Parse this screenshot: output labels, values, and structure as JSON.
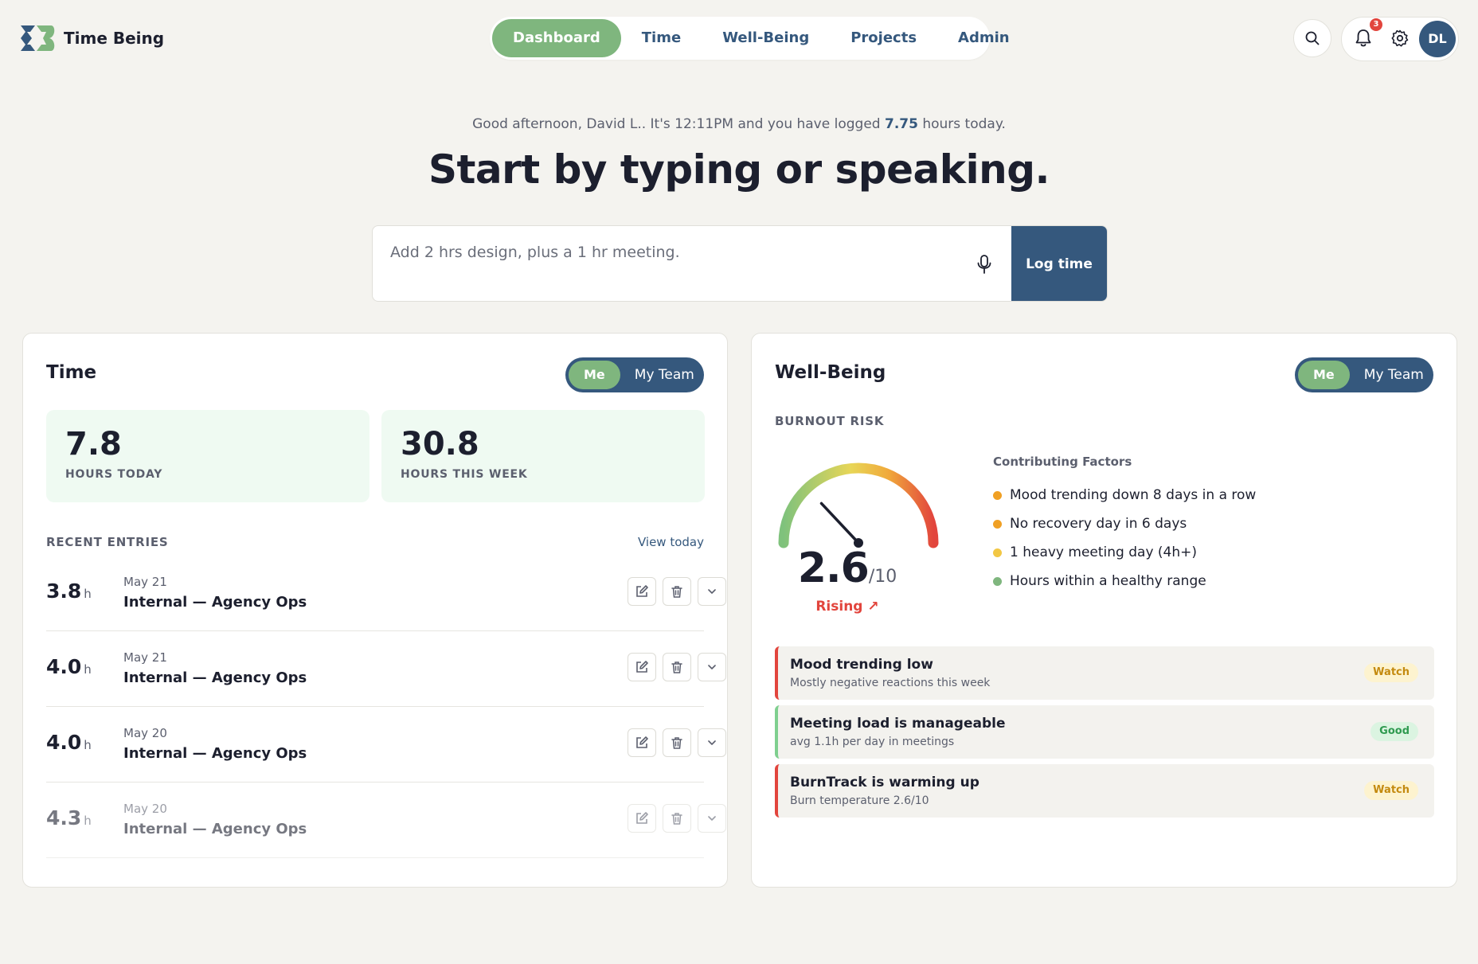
{
  "app": {
    "name": "Time Being"
  },
  "nav": {
    "items": [
      {
        "label": "Dashboard",
        "active": true
      },
      {
        "label": "Time",
        "active": false
      },
      {
        "label": "Well-Being",
        "active": false
      },
      {
        "label": "Projects",
        "active": false
      },
      {
        "label": "Admin",
        "active": false
      }
    ]
  },
  "header": {
    "notification_count": "3",
    "avatar_initials": "DL"
  },
  "hero": {
    "greeting_prefix": "Good afternoon, David L.. It's 12:11PM and you have logged ",
    "greeting_hours": "7.75",
    "greeting_suffix": " hours today.",
    "title": "Start by typing or speaking.",
    "input_placeholder": "Add 2 hrs design, plus a 1 hr meeting.",
    "log_button": "Log time"
  },
  "time_card": {
    "title": "Time",
    "toggle": {
      "me": "Me",
      "team": "My Team"
    },
    "stats": [
      {
        "value": "7.8",
        "label": "HOURS TODAY"
      },
      {
        "value": "30.8",
        "label": "HOURS THIS WEEK"
      }
    ],
    "recent_label": "RECENT ENTRIES",
    "view_today": "View today",
    "hours_unit": "h",
    "entries": [
      {
        "hours": "3.8",
        "date": "May 21",
        "name": "Internal — Agency Ops"
      },
      {
        "hours": "4.0",
        "date": "May 21",
        "name": "Internal — Agency Ops"
      },
      {
        "hours": "4.0",
        "date": "May 20",
        "name": "Internal — Agency Ops"
      },
      {
        "hours": "4.3",
        "date": "May 20",
        "name": "Internal — Agency Ops"
      }
    ]
  },
  "wellbeing_card": {
    "title": "Well-Being",
    "toggle": {
      "me": "Me",
      "team": "My Team"
    },
    "burnout_label": "BURNOUT RISK",
    "score": "2.6",
    "score_max": "/10",
    "score_value": 2.6,
    "score_scale_max": 10,
    "trend": "Rising ↗",
    "factors_title": "Contributing Factors",
    "factors": [
      {
        "text": "Mood trending down 8 days in a row",
        "color": "#f0a024"
      },
      {
        "text": "No recovery day in 6 days",
        "color": "#f0a024"
      },
      {
        "text": "1 heavy meeting day (4h+)",
        "color": "#f2c744"
      },
      {
        "text": "Hours within a healthy range",
        "color": "#7fb67e"
      }
    ],
    "alerts": [
      {
        "title": "Mood trending low",
        "subtitle": "Mostly negative reactions this week",
        "status": "Watch"
      },
      {
        "title": "Meeting load is manageable",
        "subtitle": "avg 1.1h per day in meetings",
        "status": "Good"
      },
      {
        "title": "BurnTrack is warming up",
        "subtitle": "Burn temperature 2.6/10",
        "status": "Watch"
      }
    ]
  },
  "colors": {
    "brand_blue": "#35587d",
    "brand_green": "#7fb67e",
    "alert_red": "#e2453d",
    "background": "#f4f3ef"
  }
}
